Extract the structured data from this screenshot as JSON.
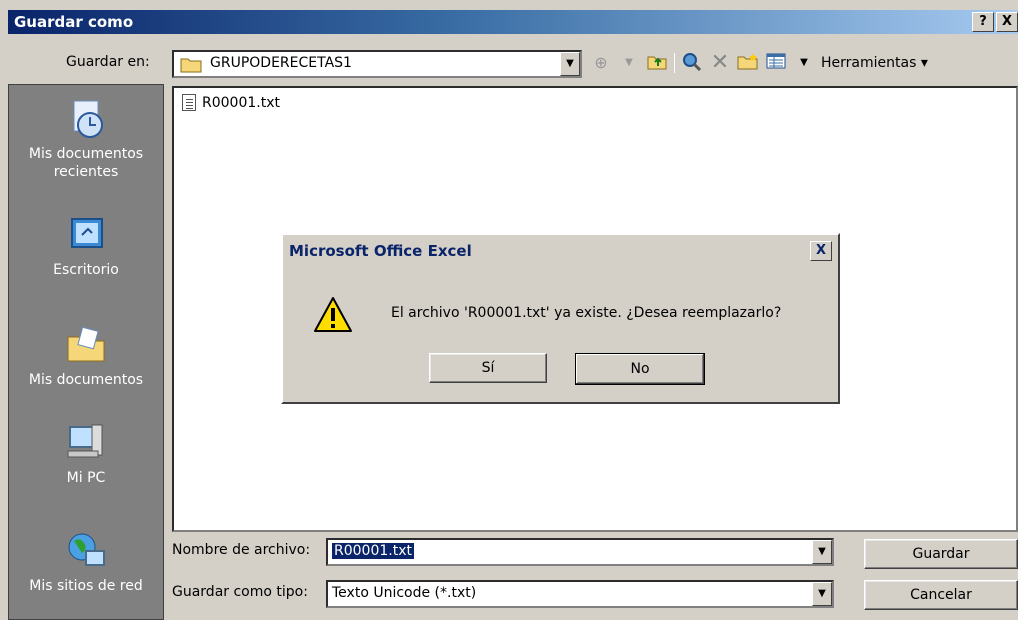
{
  "window": {
    "title": "Guardar como",
    "help_btn": "?",
    "close_btn": "X"
  },
  "top": {
    "save_in_label": "Guardar en:",
    "folder": "GRUPODERECETAS1",
    "tools_label": "Herramientas"
  },
  "places": [
    {
      "label": "Mis documentos recientes",
      "icon": "recent-documents-icon"
    },
    {
      "label": "Escritorio",
      "icon": "desktop-icon"
    },
    {
      "label": "Mis documentos",
      "icon": "my-documents-icon"
    },
    {
      "label": "Mi PC",
      "icon": "my-computer-icon"
    },
    {
      "label": "Mis sitios de red",
      "icon": "network-places-icon"
    }
  ],
  "files": [
    {
      "name": "R00001.txt"
    }
  ],
  "bottom": {
    "filename_label": "Nombre de archivo:",
    "filename_value": "R00001.txt",
    "type_label": "Guardar como tipo:",
    "type_value": "Texto Unicode (*.txt)",
    "save_button": "Guardar",
    "cancel_button": "Cancelar"
  },
  "modal": {
    "title": "Microsoft Office Excel",
    "close": "X",
    "message": "El archivo 'R00001.txt' ya existe. ¿Desea reemplazarlo?",
    "yes": "Sí",
    "no": "No"
  }
}
